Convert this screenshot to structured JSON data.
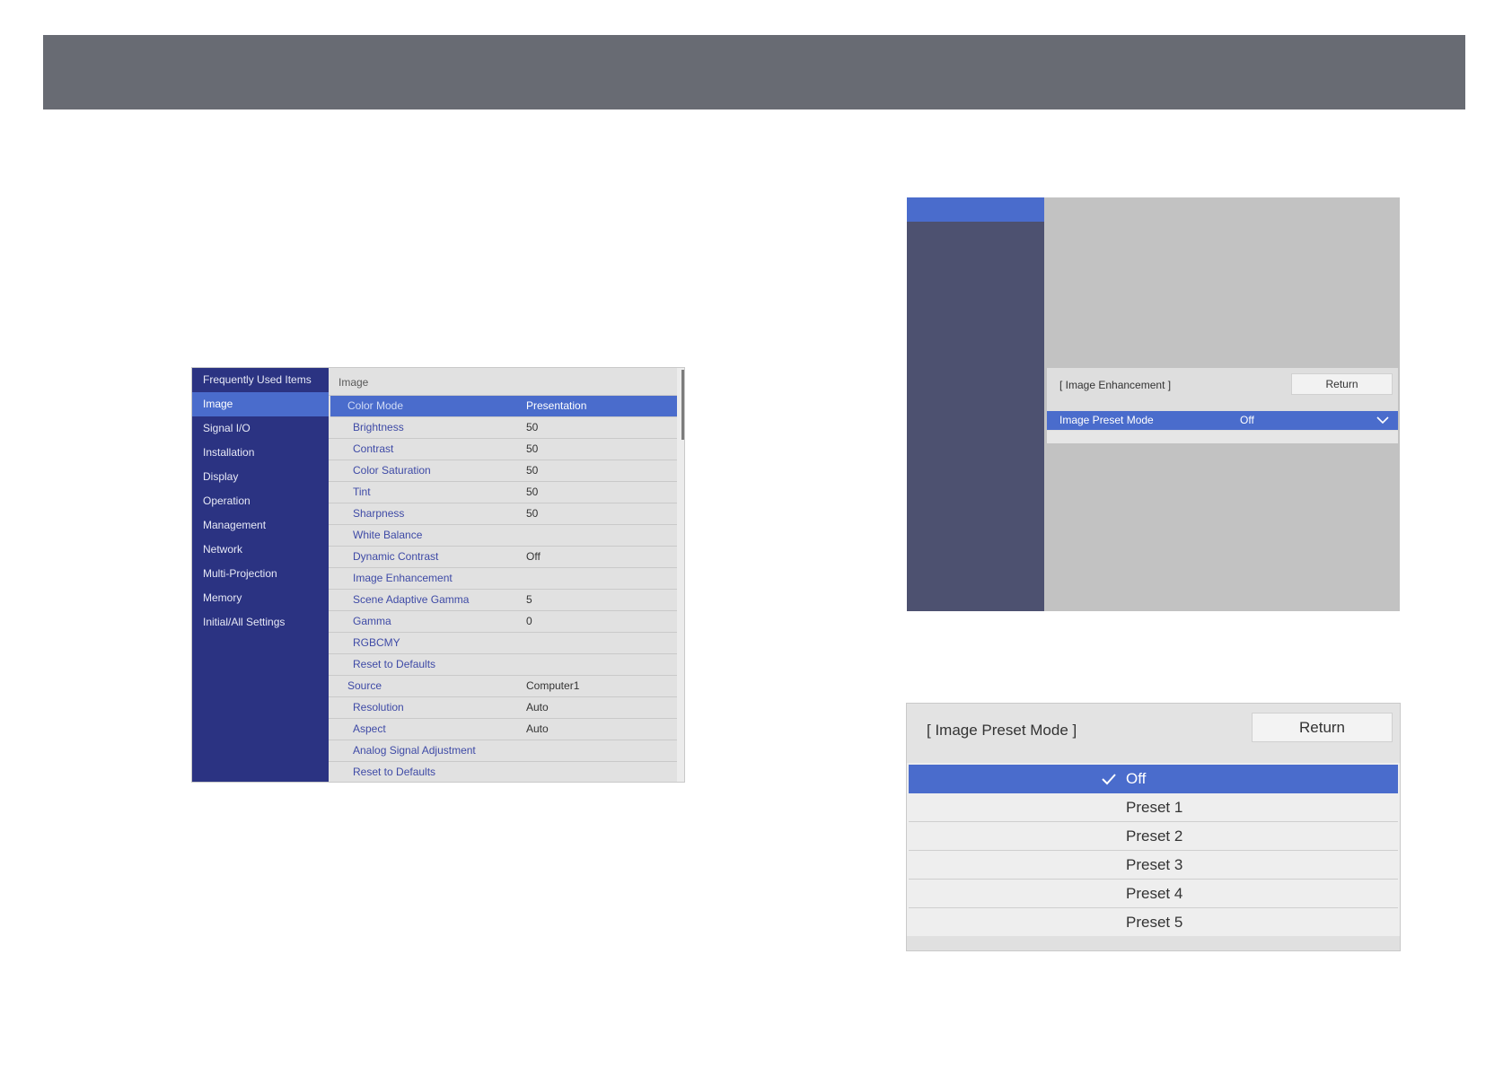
{
  "menu1": {
    "sidebar": [
      {
        "label": "Frequently Used Items",
        "active": false
      },
      {
        "label": "Image",
        "active": true
      },
      {
        "label": "Signal I/O",
        "active": false
      },
      {
        "label": "Installation",
        "active": false
      },
      {
        "label": "Display",
        "active": false
      },
      {
        "label": "Operation",
        "active": false
      },
      {
        "label": "Management",
        "active": false
      },
      {
        "label": "Network",
        "active": false
      },
      {
        "label": "Multi-Projection",
        "active": false
      },
      {
        "label": "Memory",
        "active": false
      },
      {
        "label": "Initial/All Settings",
        "active": false
      }
    ],
    "heading": "Image",
    "rows": [
      {
        "label": "Color Mode",
        "value": "Presentation",
        "selected": true,
        "top": true
      },
      {
        "label": "Brightness",
        "value": "50"
      },
      {
        "label": "Contrast",
        "value": "50"
      },
      {
        "label": "Color Saturation",
        "value": "50"
      },
      {
        "label": "Tint",
        "value": "50"
      },
      {
        "label": "Sharpness",
        "value": "50"
      },
      {
        "label": "White Balance",
        "value": ""
      },
      {
        "label": "Dynamic Contrast",
        "value": "Off"
      },
      {
        "label": "Image Enhancement",
        "value": ""
      },
      {
        "label": "Scene Adaptive Gamma",
        "value": "5"
      },
      {
        "label": "Gamma",
        "value": "0"
      },
      {
        "label": "RGBCMY",
        "value": ""
      },
      {
        "label": "Reset to Defaults",
        "value": ""
      },
      {
        "label": "Source",
        "value": "Computer1",
        "top": true
      },
      {
        "label": "Resolution",
        "value": "Auto"
      },
      {
        "label": "Aspect",
        "value": "Auto"
      },
      {
        "label": "Analog Signal Adjustment",
        "value": ""
      },
      {
        "label": "Reset to Defaults",
        "value": ""
      }
    ]
  },
  "menu2": {
    "title": "[ Image Enhancement ]",
    "return_label": "Return",
    "row_label": "Image Preset Mode",
    "row_value": "Off"
  },
  "menu3": {
    "title": "[ Image Preset Mode ]",
    "return_label": "Return",
    "items": [
      {
        "label": "Off",
        "selected": true
      },
      {
        "label": "Preset 1",
        "selected": false
      },
      {
        "label": "Preset 2",
        "selected": false
      },
      {
        "label": "Preset 3",
        "selected": false
      },
      {
        "label": "Preset 4",
        "selected": false
      },
      {
        "label": "Preset 5",
        "selected": false
      }
    ]
  },
  "colors": {
    "header_bar": "#686b73",
    "menu_sidebar": "#2b3382",
    "highlight": "#4a6ccc",
    "item_label": "#3e4aa6"
  },
  "icons": {
    "dropdown": "chevron-down-icon",
    "selected_mark": "checkmark-icon"
  }
}
